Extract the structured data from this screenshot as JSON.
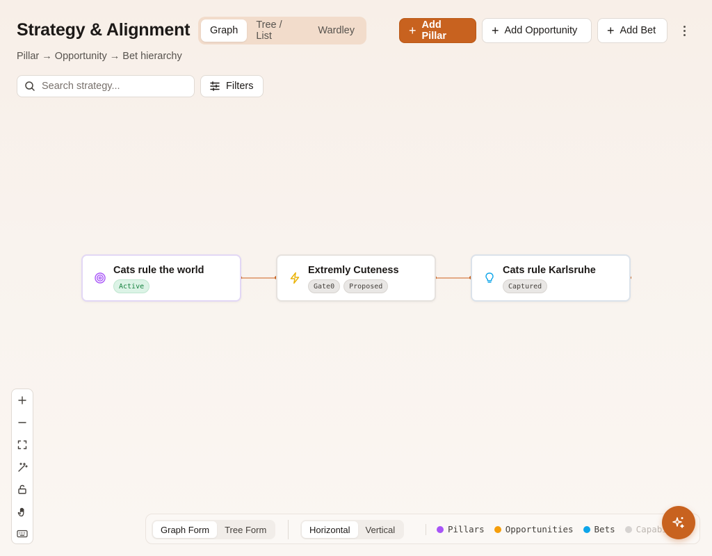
{
  "header": {
    "title": "Strategy & Alignment",
    "subtitle": "Pillar → Opportunity → Bet hierarchy"
  },
  "view_tabs": [
    {
      "label": "Graph",
      "active": true
    },
    {
      "label": "Tree / List",
      "active": false
    },
    {
      "label": "Wardley",
      "active": false
    }
  ],
  "toolbar": {
    "add_pillar": "Add Pillar",
    "add_opportunity": "Add Opportunity",
    "add_bet": "Add Bet",
    "more_icon": "more-vertical-icon"
  },
  "search": {
    "placeholder": "Search strategy...",
    "value": ""
  },
  "filters": {
    "label": "Filters"
  },
  "nodes": [
    {
      "title": "Cats rule the world",
      "type": "pillar",
      "icon": "target-icon",
      "badges": [
        "Active"
      ]
    },
    {
      "title": "Extremly Cuteness",
      "type": "opportunity",
      "icon": "lightning-icon",
      "badges": [
        "Gate0",
        "Proposed"
      ]
    },
    {
      "title": "Cats rule Karlsruhe",
      "type": "bet",
      "icon": "lightbulb-icon",
      "badges": [
        "Captured"
      ]
    }
  ],
  "zoom_controls": [
    "zoom-in-icon",
    "zoom-out-icon",
    "fit-view-icon",
    "auto-layout-icon",
    "lock-icon",
    "pan-hand-icon",
    "keyboard-icon"
  ],
  "bottom_bar": {
    "form_tabs": [
      {
        "label": "Graph Form",
        "active": true
      },
      {
        "label": "Tree Form",
        "active": false
      }
    ],
    "orientation_tabs": [
      {
        "label": "Horizontal",
        "active": true
      },
      {
        "label": "Vertical",
        "active": false
      }
    ],
    "legend": [
      {
        "label": "Pillars",
        "color": "#a855f7"
      },
      {
        "label": "Opportunities",
        "color": "#f59e0b"
      },
      {
        "label": "Bets",
        "color": "#0ea5e9"
      },
      {
        "label": "Capabi",
        "color": "#d6d3d1"
      }
    ]
  },
  "colors": {
    "accent": "#c8621f",
    "pillar": "#a855f7",
    "opportunity": "#eab308",
    "bet": "#0ea5e9"
  }
}
